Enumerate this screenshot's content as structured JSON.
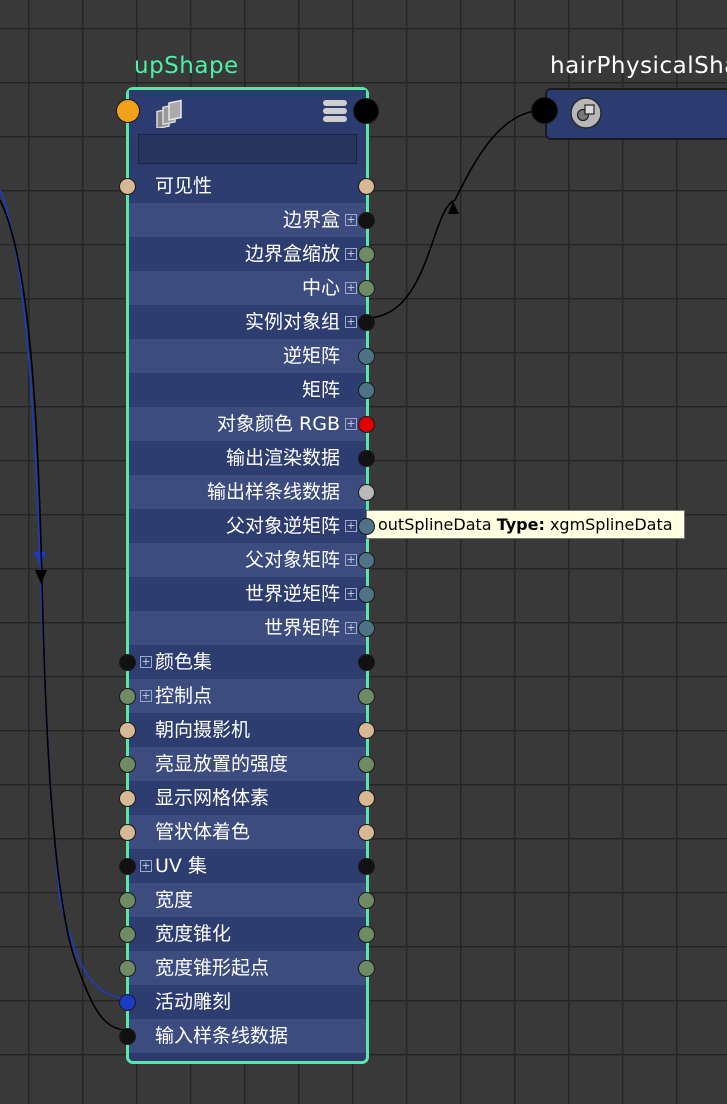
{
  "nodes": {
    "up_shape": {
      "title": "upShape",
      "attributes": [
        {
          "label": "可见性",
          "align": "left",
          "expand": false,
          "in_port": "#d7b894",
          "out_port": "#d7b894"
        },
        {
          "label": "边界盒",
          "align": "right",
          "expand": true,
          "in_port": null,
          "out_port": "#111111"
        },
        {
          "label": "边界盒缩放",
          "align": "right",
          "expand": true,
          "in_port": null,
          "out_port": "#6e8b63"
        },
        {
          "label": "中心",
          "align": "right",
          "expand": true,
          "in_port": null,
          "out_port": "#6e8b63"
        },
        {
          "label": "实例对象组",
          "align": "right",
          "expand": true,
          "in_port": null,
          "out_port": "#111111"
        },
        {
          "label": "逆矩阵",
          "align": "right",
          "expand": false,
          "in_port": null,
          "out_port": "#4f7386"
        },
        {
          "label": "矩阵",
          "align": "right",
          "expand": false,
          "in_port": null,
          "out_port": "#4f7386"
        },
        {
          "label": "对象颜色 RGB",
          "align": "right",
          "expand": true,
          "in_port": null,
          "out_port": "#e00000"
        },
        {
          "label": "输出渲染数据",
          "align": "right",
          "expand": false,
          "in_port": null,
          "out_port": "#111111"
        },
        {
          "label": "输出样条线数据",
          "align": "right",
          "expand": false,
          "in_port": null,
          "out_port": "#b9b9b9"
        },
        {
          "label": "父对象逆矩阵",
          "align": "right",
          "expand": true,
          "in_port": null,
          "out_port": "#4f7386"
        },
        {
          "label": "父对象矩阵",
          "align": "right",
          "expand": true,
          "in_port": null,
          "out_port": "#4f7386"
        },
        {
          "label": "世界逆矩阵",
          "align": "right",
          "expand": true,
          "in_port": null,
          "out_port": "#4f7386"
        },
        {
          "label": "世界矩阵",
          "align": "right",
          "expand": true,
          "in_port": null,
          "out_port": "#4f7386"
        },
        {
          "label": "颜色集",
          "align": "left",
          "expand": true,
          "in_port": "#111111",
          "out_port": "#111111"
        },
        {
          "label": "控制点",
          "align": "left",
          "expand": true,
          "in_port": "#6e8b63",
          "out_port": "#6e8b63"
        },
        {
          "label": "朝向摄影机",
          "align": "left",
          "expand": false,
          "in_port": "#d7b894",
          "out_port": "#d7b894"
        },
        {
          "label": "亮显放置的强度",
          "align": "left",
          "expand": false,
          "in_port": "#6e8b63",
          "out_port": "#6e8b63"
        },
        {
          "label": "显示网格体素",
          "align": "left",
          "expand": false,
          "in_port": "#d7b894",
          "out_port": "#d7b894"
        },
        {
          "label": "管状体着色",
          "align": "left",
          "expand": false,
          "in_port": "#d7b894",
          "out_port": "#d7b894"
        },
        {
          "label": "UV 集",
          "align": "left",
          "expand": true,
          "in_port": "#111111",
          "out_port": "#111111"
        },
        {
          "label": "宽度",
          "align": "left",
          "expand": false,
          "in_port": "#6e8b63",
          "out_port": "#6e8b63"
        },
        {
          "label": "宽度锥化",
          "align": "left",
          "expand": false,
          "in_port": "#6e8b63",
          "out_port": "#6e8b63"
        },
        {
          "label": "宽度锥形起点",
          "align": "left",
          "expand": false,
          "in_port": "#6e8b63",
          "out_port": "#6e8b63"
        },
        {
          "label": "活动雕刻",
          "align": "left",
          "expand": false,
          "in_port": "#1a3cc8",
          "out_port": null
        },
        {
          "label": "输入样条线数据",
          "align": "left",
          "expand": false,
          "in_port": "#111111",
          "out_port": null
        }
      ]
    },
    "hair_physical_shader": {
      "title": "hairPhysicalShac"
    }
  },
  "tooltip": {
    "attr_name": "outSplineData",
    "type_label": "Type:",
    "type_value": "xgmSplineData"
  },
  "colors": {
    "background": "#393939",
    "grid": "#252525",
    "node_border_selected": "#56e8a6",
    "node_title_selected": "#4cf0a8",
    "row_odd": "#2e3d70",
    "row_even": "#3d4c7f",
    "wire_black": "#000000",
    "wire_blue": "#1a3cc8"
  },
  "icons": {
    "node_input_port": "orange-circle",
    "node_type": "xgen-spline-stack-icon",
    "node_menu": "hamburger-menu-icon",
    "shader_type": "shader-sphere-icon"
  }
}
